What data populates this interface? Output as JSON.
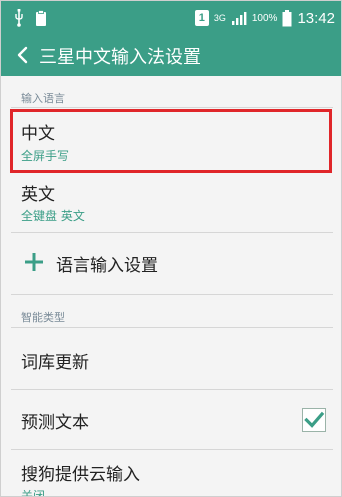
{
  "status_bar": {
    "sim": "1",
    "network": "3G",
    "battery": "100%",
    "time": "13:42",
    "icons": [
      "usb-icon",
      "clipboard-icon",
      "signal-icon",
      "battery-icon"
    ]
  },
  "action_bar": {
    "title": "三星中文输入法设置",
    "back_icon": "chevron-left-icon"
  },
  "sections": {
    "input_language": "输入语言",
    "smart_type": "智能类型"
  },
  "languages": [
    {
      "title": "中文",
      "subtitle": "全屏手写"
    },
    {
      "title": "英文",
      "subtitle": "全键盘 英文"
    }
  ],
  "language_settings_label": "语言输入设置",
  "smart_items": {
    "dictionary_update": "词库更新",
    "predictive_text": "预测文本",
    "predictive_checked": true,
    "sogou_cloud": "搜狗提供云输入",
    "sogou_cloud_sub": "关闭"
  },
  "colors": {
    "accent": "#3b9e87",
    "highlight": "#e0262a"
  }
}
